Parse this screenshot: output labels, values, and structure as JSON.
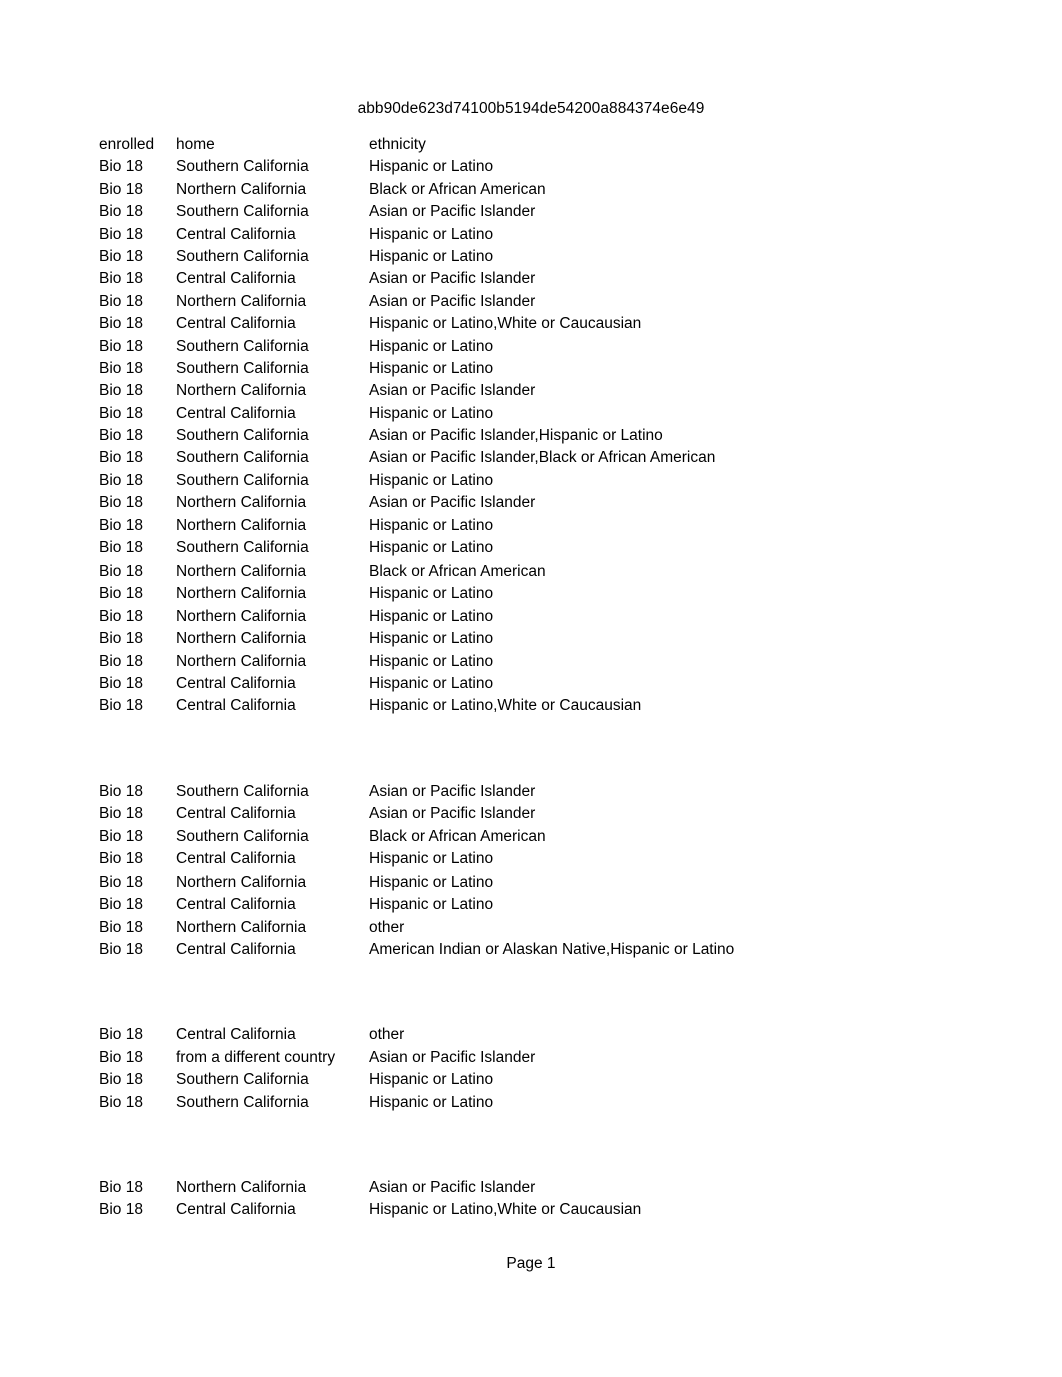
{
  "document": {
    "title": "abb90de623d74100b5194de54200a884374e6e49",
    "footer": "Page 1"
  },
  "table": {
    "columns": [
      {
        "key": "enrolled",
        "label": "enrolled"
      },
      {
        "key": "home",
        "label": "home"
      },
      {
        "key": "ethnicity",
        "label": "ethnicity"
      }
    ],
    "blocks": [
      {
        "rows": [
          {
            "enrolled": "Bio 18",
            "home": "Southern California",
            "ethnicity": "Hispanic or Latino"
          },
          {
            "enrolled": "Bio 18",
            "home": "Northern California",
            "ethnicity": "Black or African American"
          },
          {
            "enrolled": "Bio 18",
            "home": "Southern California",
            "ethnicity": "Asian or Pacific Islander"
          },
          {
            "enrolled": "Bio 18",
            "home": "Central California",
            "ethnicity": "Hispanic or Latino"
          },
          {
            "enrolled": "Bio 18",
            "home": "Southern California",
            "ethnicity": "Hispanic or Latino"
          },
          {
            "enrolled": "Bio 18",
            "home": "Central California",
            "ethnicity": "Asian or Pacific Islander"
          },
          {
            "enrolled": "Bio 18",
            "home": "Northern California",
            "ethnicity": "Asian or Pacific Islander"
          },
          {
            "enrolled": "Bio 18",
            "home": "Central California",
            "ethnicity": "Hispanic or Latino,White or Caucausian"
          },
          {
            "enrolled": "Bio 18",
            "home": "Southern California",
            "ethnicity": "Hispanic or Latino"
          },
          {
            "enrolled": "Bio 18",
            "home": "Southern California",
            "ethnicity": "Hispanic or Latino"
          },
          {
            "enrolled": "Bio 18",
            "home": "Northern California",
            "ethnicity": "Asian or Pacific Islander"
          },
          {
            "enrolled": "Bio 18",
            "home": "Central California",
            "ethnicity": "Hispanic or Latino"
          },
          {
            "enrolled": "Bio 18",
            "home": "Southern California",
            "ethnicity": "Asian or Pacific Islander,Hispanic or Latino"
          },
          {
            "enrolled": "Bio 18",
            "home": "Southern California",
            "ethnicity": "Asian or Pacific Islander,Black or African American"
          },
          {
            "enrolled": "Bio 18",
            "home": "Southern California",
            "ethnicity": "Hispanic or Latino"
          },
          {
            "enrolled": "Bio 18",
            "home": "Northern California",
            "ethnicity": "Asian or Pacific Islander"
          },
          {
            "enrolled": "Bio 18",
            "home": "Northern California",
            "ethnicity": "Hispanic or Latino"
          },
          {
            "enrolled": "Bio 18",
            "home": "Southern California",
            "ethnicity": "Hispanic or Latino"
          },
          {
            "enrolled": "Bio 18",
            "home": "Northern California",
            "ethnicity": "Black or African American",
            "extra_gap": true
          },
          {
            "enrolled": "Bio 18",
            "home": "Northern California",
            "ethnicity": "Hispanic or Latino"
          },
          {
            "enrolled": "Bio 18",
            "home": "Northern California",
            "ethnicity": "Hispanic or Latino"
          },
          {
            "enrolled": "Bio 18",
            "home": "Northern California",
            "ethnicity": "Hispanic or Latino"
          },
          {
            "enrolled": "Bio 18",
            "home": "Northern California",
            "ethnicity": "Hispanic or Latino"
          },
          {
            "enrolled": "Bio 18",
            "home": "Central California",
            "ethnicity": "Hispanic or Latino"
          },
          {
            "enrolled": "Bio 18",
            "home": "Central California",
            "ethnicity": "Hispanic or Latino,White or Caucausian"
          }
        ]
      },
      {
        "rows": [
          {
            "enrolled": "Bio 18",
            "home": "Southern California",
            "ethnicity": "Asian or Pacific Islander"
          },
          {
            "enrolled": "Bio 18",
            "home": "Central California",
            "ethnicity": "Asian or Pacific Islander"
          },
          {
            "enrolled": "Bio 18",
            "home": "Southern California",
            "ethnicity": "Black or African American"
          },
          {
            "enrolled": "Bio 18",
            "home": "Central California",
            "ethnicity": "Hispanic or Latino"
          },
          {
            "enrolled": "Bio 18",
            "home": "Northern California",
            "ethnicity": "Hispanic or Latino",
            "extra_gap": true
          },
          {
            "enrolled": "Bio 18",
            "home": "Central California",
            "ethnicity": "Hispanic or Latino"
          },
          {
            "enrolled": "Bio 18",
            "home": "Northern California",
            "ethnicity": "other"
          },
          {
            "enrolled": "Bio 18",
            "home": "Central California",
            "ethnicity": "American Indian or Alaskan Native,Hispanic or Latino"
          }
        ]
      },
      {
        "rows": [
          {
            "enrolled": "Bio 18",
            "home": "Central California",
            "ethnicity": "other"
          },
          {
            "enrolled": "Bio 18",
            "home": "from a different country",
            "ethnicity": "Asian or Pacific Islander"
          },
          {
            "enrolled": "Bio 18",
            "home": "Southern California",
            "ethnicity": "Hispanic or Latino"
          },
          {
            "enrolled": "Bio 18",
            "home": "Southern California",
            "ethnicity": "Hispanic or Latino"
          }
        ]
      },
      {
        "rows": [
          {
            "enrolled": "Bio 18",
            "home": "Northern California",
            "ethnicity": "Asian or Pacific Islander"
          },
          {
            "enrolled": "Bio 18",
            "home": "Central California",
            "ethnicity": "Hispanic or Latino,White or Caucausian"
          }
        ]
      }
    ]
  }
}
